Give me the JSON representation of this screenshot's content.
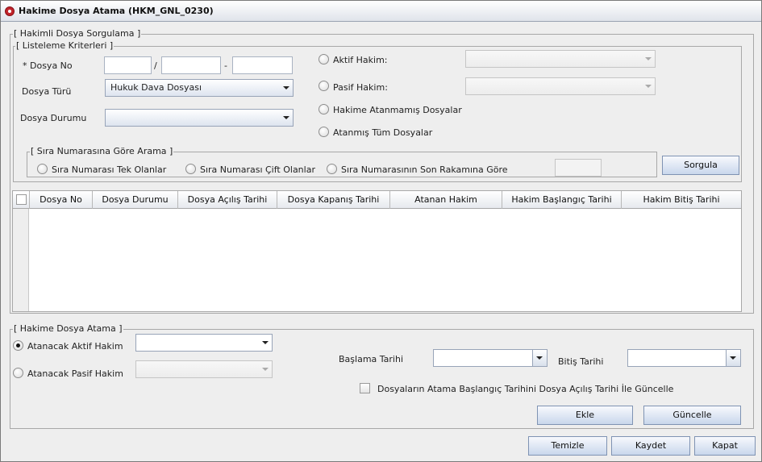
{
  "window": {
    "title": "Hakime Dosya Atama (HKM_GNL_0230)"
  },
  "search": {
    "group_title": "[ Hakimli Dosya Sorgulama ]",
    "criteria_title": "[ Listeleme Kriterleri ]",
    "dosya_no_label": "* Dosya No",
    "dosya_no_sep1": "/",
    "dosya_no_sep2": "-",
    "dosya_turu_label": "Dosya Türü",
    "dosya_turu_value": "Hukuk Dava Dosyası",
    "dosya_durumu_label": "Dosya Durumu",
    "dosya_durumu_value": "",
    "aktif_hakim_label": "Aktif Hakim:",
    "pasif_hakim_label": "Pasif Hakim:",
    "atanmamis_label": "Hakime Atanmamış Dosyalar",
    "atanmis_label": "Atanmış Tüm Dosyalar",
    "sira_title": "[ Sıra Numarasına Göre Arama ]",
    "sira_tek_label": "Sıra Numarası Tek Olanlar",
    "sira_cift_label": "Sıra Numarası Çift Olanlar",
    "sira_son_label": "Sıra Numarasının Son Rakamına Göre",
    "sorgula_label": "Sorgula"
  },
  "table": {
    "columns": [
      "Dosya No",
      "Dosya Durumu",
      "Dosya Açılış Tarihi",
      "Dosya Kapanış Tarihi",
      "Atanan Hakim",
      "Hakim Başlangıç Tarihi",
      "Hakim Bitiş Tarihi"
    ],
    "rows": []
  },
  "assign": {
    "group_title": "[ Hakime Dosya Atama ]",
    "aktif_label": "Atanacak Aktif Hakim",
    "pasif_label": "Atanacak Pasif Hakim",
    "baslama_label": "Başlama Tarihi",
    "bitis_label": "Bitiş Tarihi",
    "guncelle_check_label": "Dosyaların Atama Başlangıç Tarihini Dosya Açılış Tarihi İle Güncelle",
    "ekle_label": "Ekle",
    "guncelle_label": "Güncelle"
  },
  "footer": {
    "temizle_label": "Temizle",
    "kaydet_label": "Kaydet",
    "kapat_label": "Kapat"
  }
}
